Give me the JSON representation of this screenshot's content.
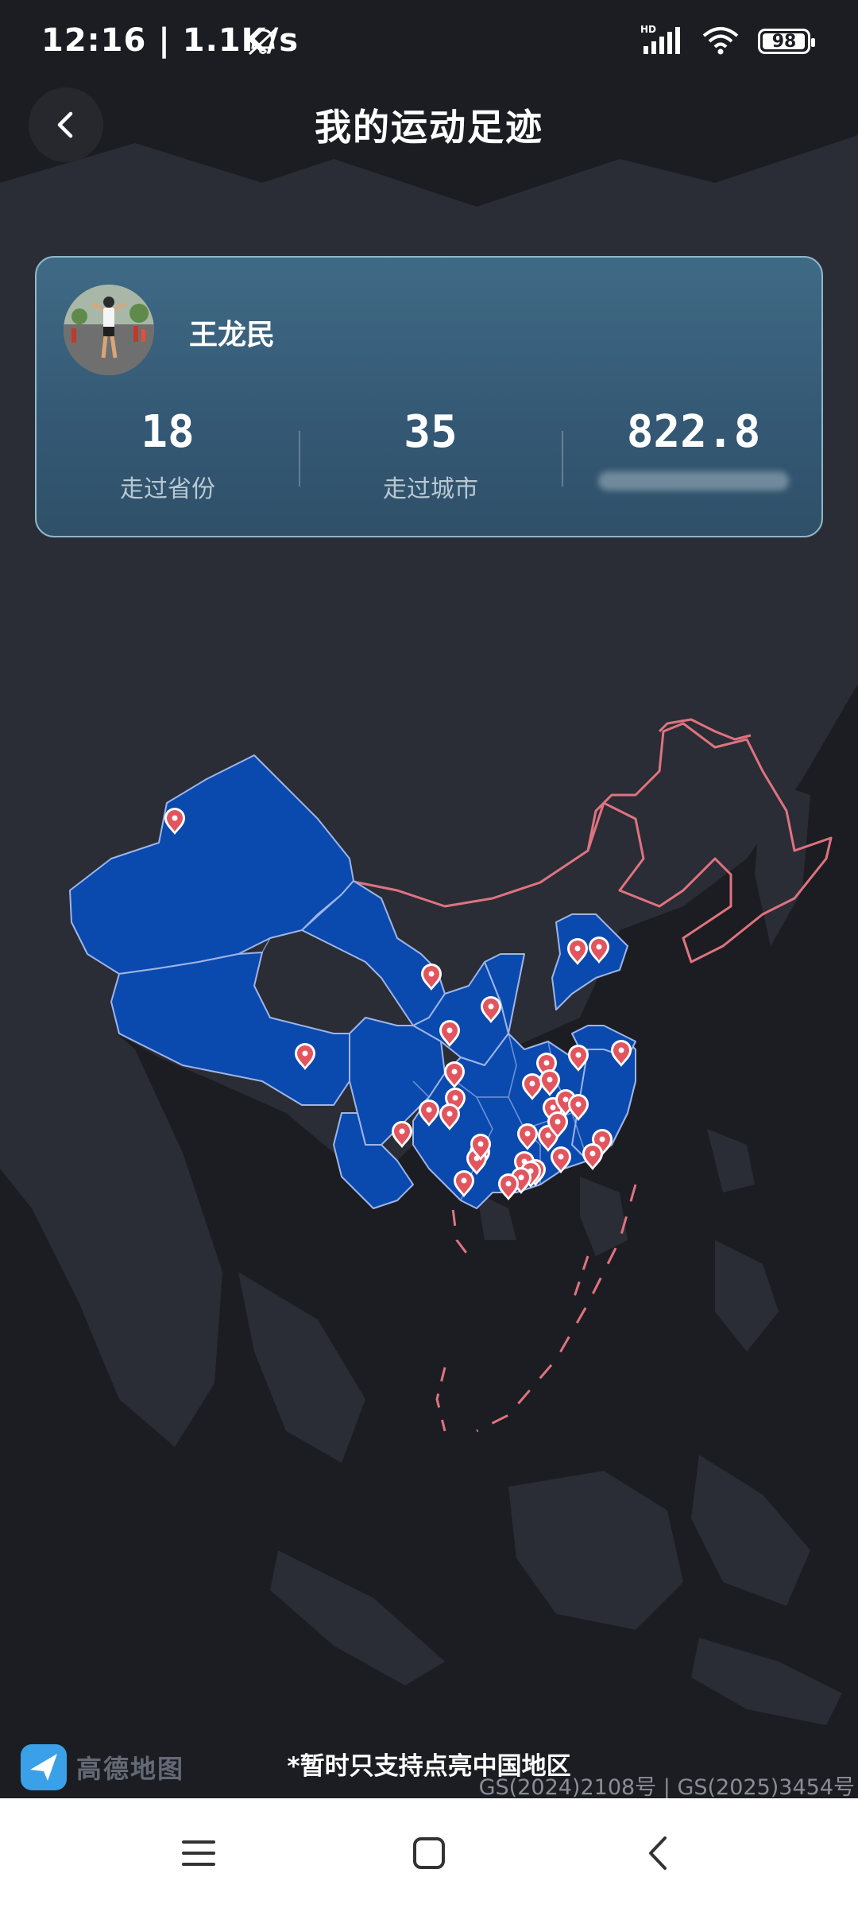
{
  "status_bar": {
    "time": "12:16 | 1.1K/s",
    "network": "HD",
    "battery": "98"
  },
  "header": {
    "title": "我的运动足迹"
  },
  "profile": {
    "name": "王龙民",
    "stats": [
      {
        "value": "18",
        "label": "走过省份"
      },
      {
        "value": "35",
        "label": "走过城市"
      },
      {
        "value": "822.8",
        "label": ""
      }
    ]
  },
  "map": {
    "highlight_color": "#0a4aae",
    "pin_color": "#e2555e",
    "border_color": "#e07380",
    "pin_count": 35
  },
  "footer": {
    "notice": "*暂时只支持点亮中国地区",
    "logo_text": "高德地图",
    "copyright": "GS(2024)2108号 | GS(2025)3454号"
  },
  "nav": {
    "icons": [
      "menu-icon",
      "home-square-icon",
      "back-chevron-icon"
    ]
  }
}
